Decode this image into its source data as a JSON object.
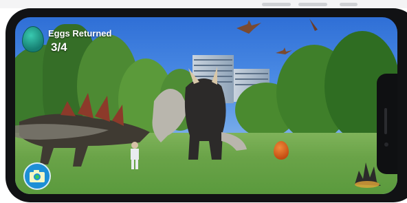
{
  "hud": {
    "title": "Eggs Returned",
    "count": "3/4"
  },
  "controls": {
    "camera_icon": "camera-icon"
  },
  "scene": {
    "sky_color": "#3f80df",
    "grass_color": "#6aa348",
    "egg_colors": [
      "#1f9c8a",
      "#e06a24"
    ]
  }
}
